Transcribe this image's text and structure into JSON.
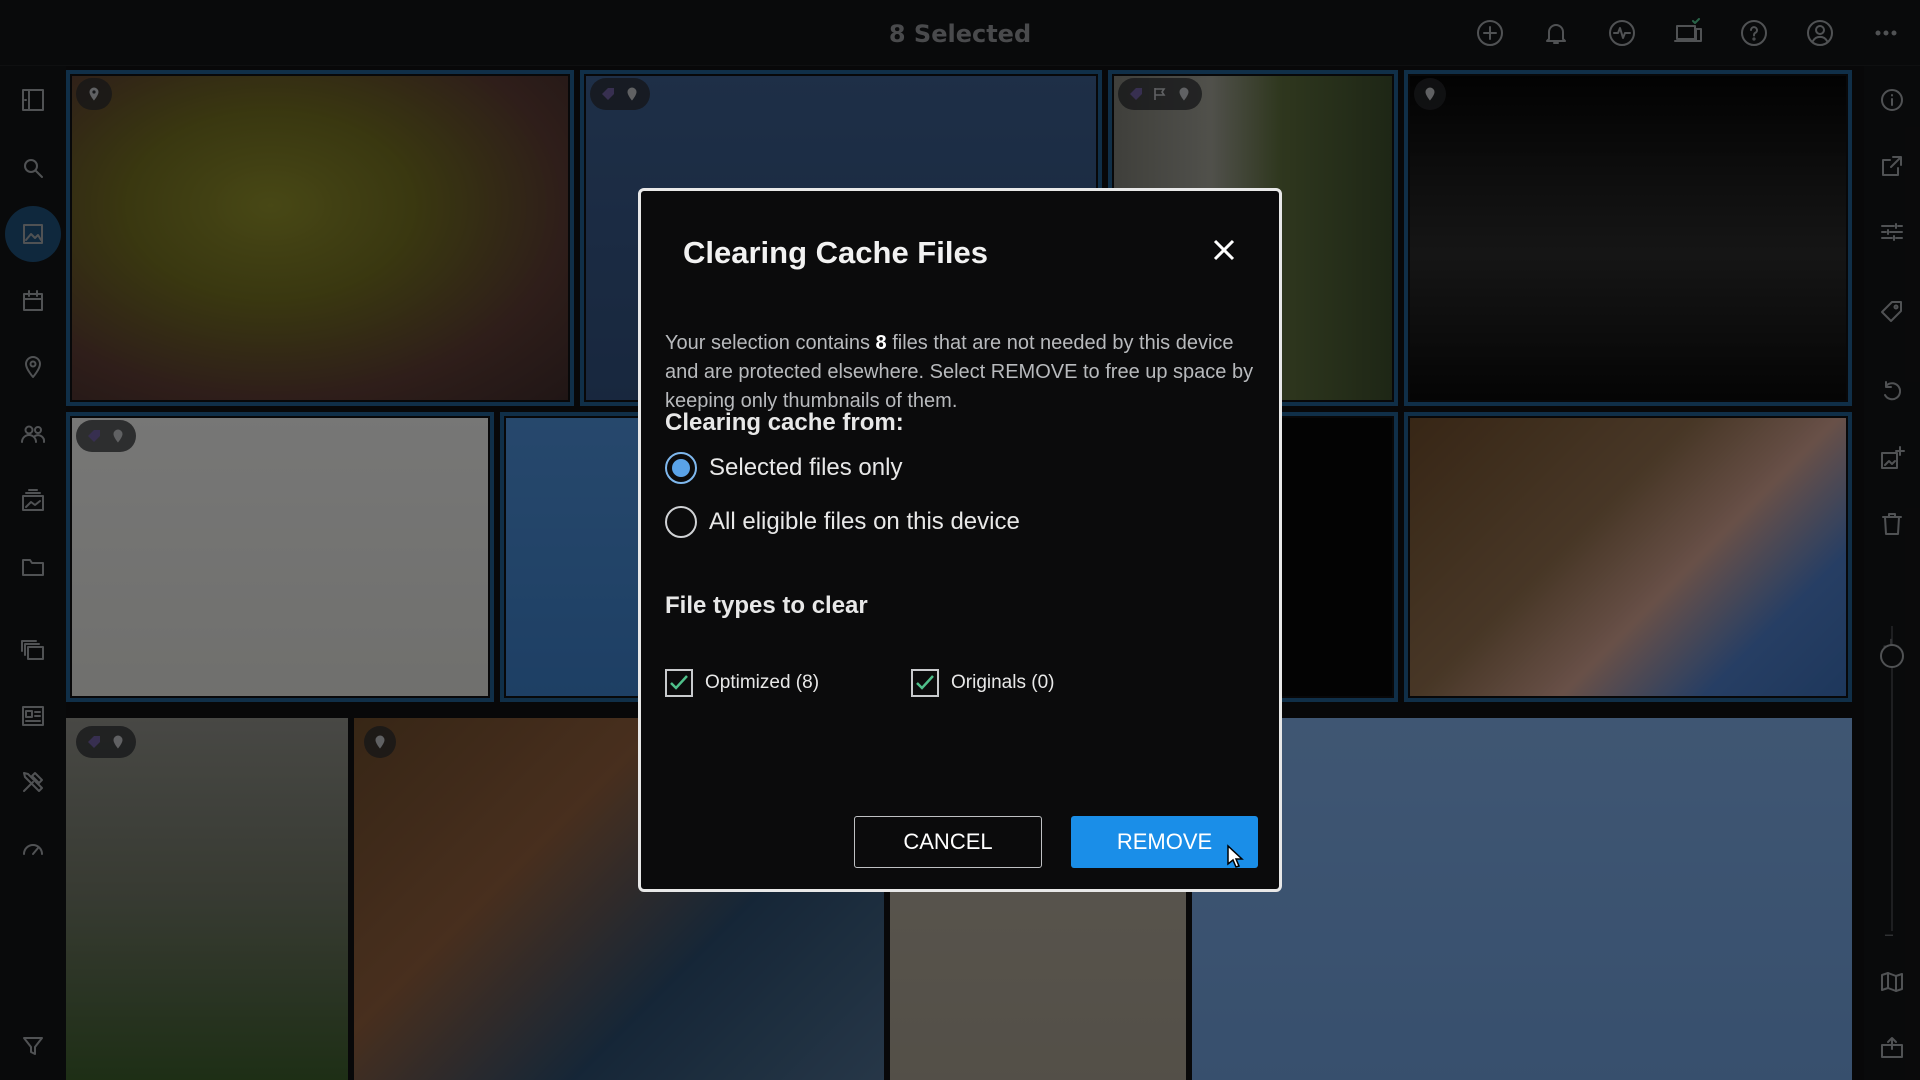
{
  "topbar": {
    "title": "8 Selected",
    "icons": [
      "add-icon",
      "bell-icon",
      "activity-icon",
      "devices-icon",
      "help-icon",
      "account-icon",
      "more-icon"
    ]
  },
  "leftbar": {
    "icons": [
      "sidebar-toggle-icon",
      "search-icon",
      "photos-icon",
      "calendar-icon",
      "location-icon",
      "people-icon",
      "albums-icon",
      "folders-icon",
      "stack-icon",
      "dashboard-icon",
      "tools-icon",
      "speed-icon",
      "filter-icon"
    ],
    "active": "photos-icon"
  },
  "rightbar": {
    "icons": [
      "info-icon",
      "share-icon",
      "adjust-icon",
      "tag-icon",
      "rotate-icon",
      "add-to-album-icon",
      "trash-icon",
      "map-icon",
      "export-icon",
      "more-vertical-icon"
    ]
  },
  "dialog": {
    "title": "Clearing Cache Files",
    "desc_pre": "Your selection contains ",
    "desc_count": "8",
    "desc_post": " files that are not needed by this device and are protected elsewhere. Select REMOVE to free up space by keeping only thumbnails of them.",
    "clearing_from_heading": "Clearing cache from:",
    "options": [
      {
        "label": "Selected files only",
        "selected": true
      },
      {
        "label": "All eligible files on this device",
        "selected": false
      }
    ],
    "file_types_heading": "File types to clear",
    "file_types": [
      {
        "label": "Optimized (8)",
        "checked": true
      },
      {
        "label": "Originals (0)",
        "checked": true
      }
    ],
    "cancel_label": "CANCEL",
    "remove_label": "REMOVE"
  },
  "colors": {
    "accent": "#1a8ee8",
    "selection": "#1f5a8a",
    "check": "#4fbf8a"
  }
}
